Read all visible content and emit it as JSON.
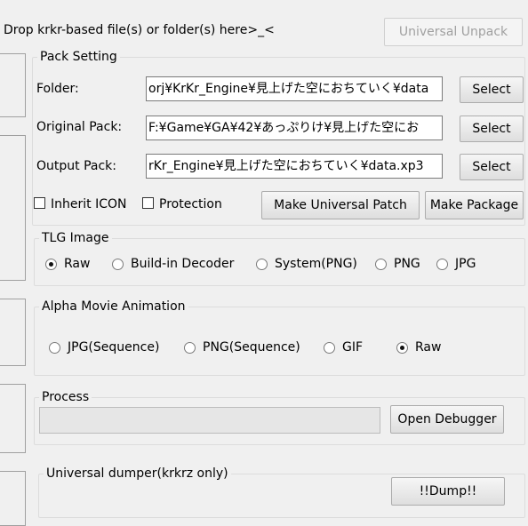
{
  "drop_label": "Drop krkr-based file(s) or folder(s) here>_<",
  "universal_unpack_label": "Universal Unpack",
  "pack_setting": {
    "title": "Pack Setting",
    "folder_label": "Folder:",
    "folder_value": "orj¥KrKr_Engine¥見上げた空におちていく¥data",
    "original_label": "Original Pack:",
    "original_value": "F:¥Game¥GA¥42¥あっぷりけ¥見上げた空にお",
    "output_label": "Output Pack:",
    "output_value": "rKr_Engine¥見上げた空におちていく¥data.xp3",
    "select_label": "Select",
    "inherit_icon_label": "Inherit ICON",
    "inherit_icon_checked": false,
    "protection_label": "Protection",
    "protection_checked": false,
    "make_patch_label": "Make Universal Patch",
    "make_package_label": "Make Package"
  },
  "tlg": {
    "title": "TLG Image",
    "options": [
      "Raw",
      "Build-in Decoder",
      "System(PNG)",
      "PNG",
      "JPG"
    ],
    "selected": "Raw"
  },
  "alpha": {
    "title": "Alpha Movie Animation",
    "options": [
      "JPG(Sequence)",
      "PNG(Sequence)",
      "GIF",
      "Raw"
    ],
    "selected": "Raw"
  },
  "process": {
    "title": "Process",
    "open_debugger_label": "Open Debugger"
  },
  "dumper": {
    "title": "Universal dumper(krkrz only)",
    "dump_label": "!!Dump!!"
  }
}
